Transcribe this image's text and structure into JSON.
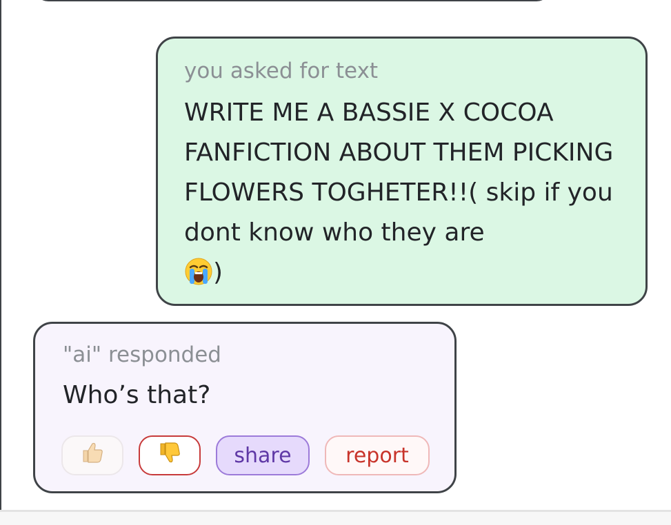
{
  "user_message": {
    "label": "you asked for text",
    "text": "WRITE ME A BASSIE X COCOA FANFICTION ABOUT THEM PICKING FLOWERS TOGHETER!!( skip if you dont know who they are",
    "emoji_icon": "loudly-crying-face-icon",
    "closing": ")"
  },
  "ai_message": {
    "label": "\"ai\" responded",
    "text": "Who’s that?"
  },
  "actions": {
    "like_icon": "thumbs-up-icon",
    "dislike_icon": "thumbs-down-icon",
    "share_label": "share",
    "report_label": "report"
  },
  "colors": {
    "user_bubble_bg": "#dbf7e4",
    "ai_bubble_bg": "#f8f4fd",
    "border": "#3f4347",
    "share_accent": "#9c7ad9",
    "report_accent": "#c8342b",
    "dislike_accent": "#c73a3a"
  }
}
